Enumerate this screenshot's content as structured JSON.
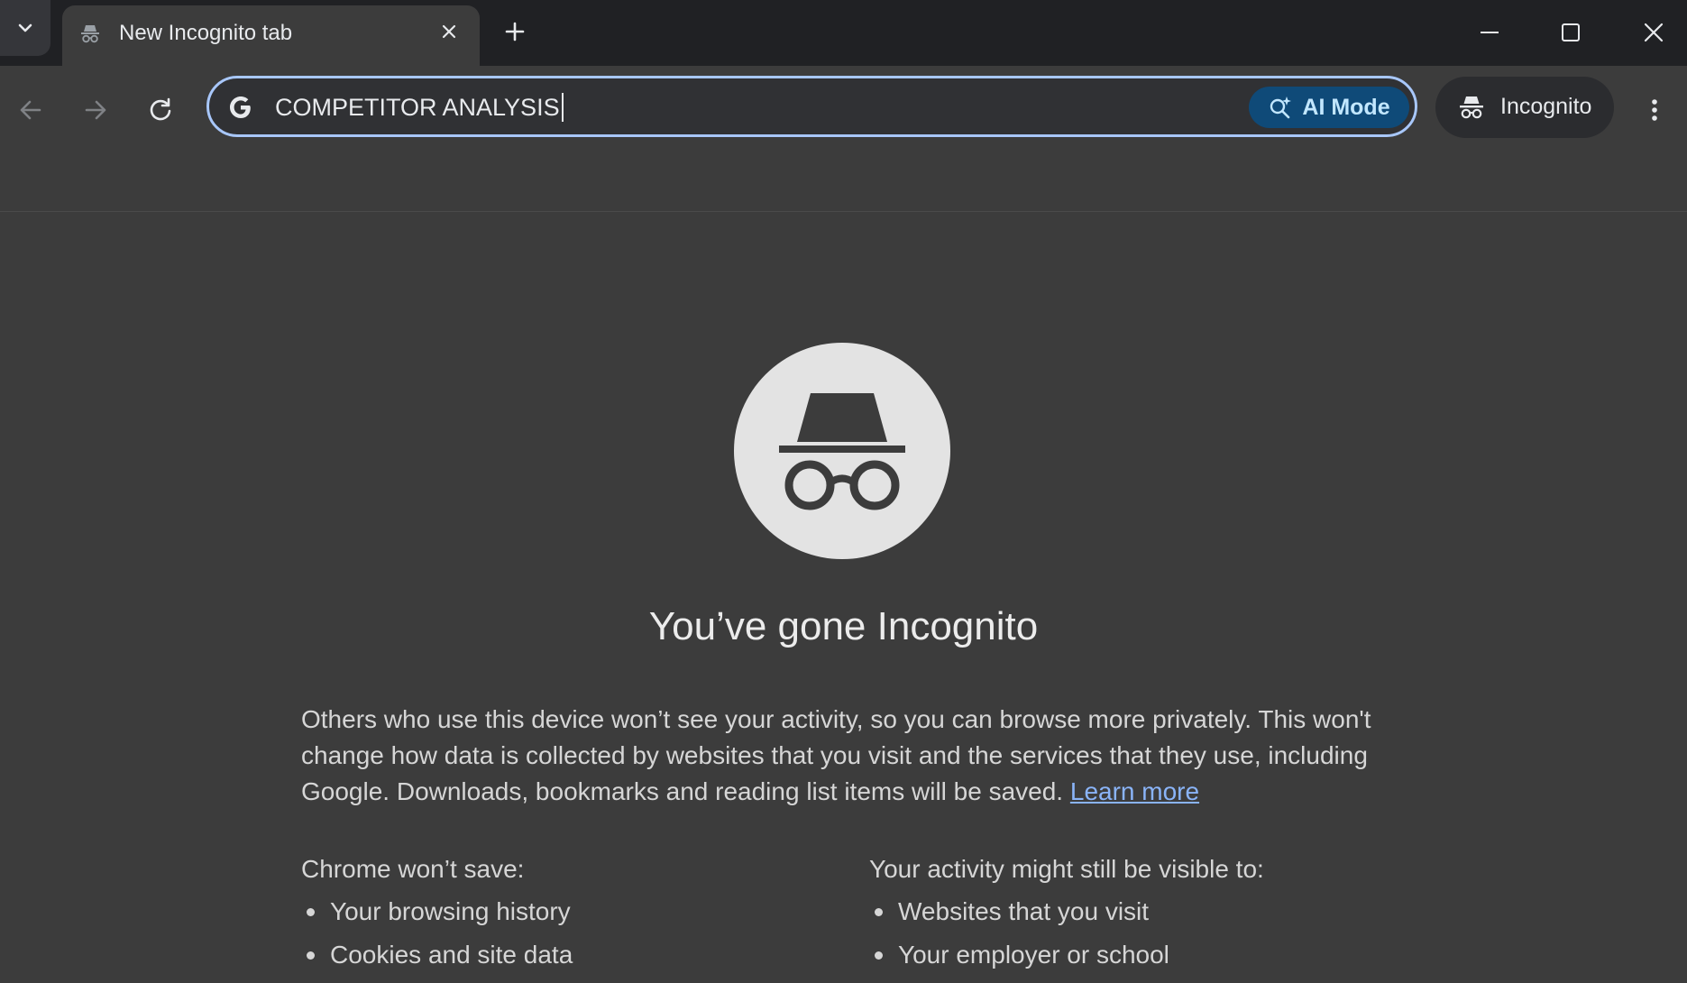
{
  "window": {
    "tab_title": "New Incognito tab",
    "tab_icon": "incognito-icon"
  },
  "toolbar": {
    "omnibox_text": "COMPETITOR ANALYSIS",
    "search_engine_icon": "google-g-icon",
    "ai_mode_label": "AI Mode",
    "profile_label": "Incognito"
  },
  "colors": {
    "focus_ring": "#a8c7fa",
    "ai_mode_bg": "#0f4a78",
    "link": "#8ab4f8"
  },
  "content": {
    "title": "You’ve gone Incognito",
    "description": "Others who use this device won’t see your activity, so you can browse more privately. This won't change how data is collected by websites that you visit and the services that they use, including Google. Downloads, bookmarks and reading list items will be saved.",
    "learn_more": "Learn more",
    "left_column": {
      "heading": "Chrome won’t save:",
      "items": [
        "Your browsing history",
        "Cookies and site data"
      ]
    },
    "right_column": {
      "heading": "Your activity might still be visible to:",
      "items": [
        "Websites that you visit",
        "Your employer or school"
      ]
    }
  }
}
